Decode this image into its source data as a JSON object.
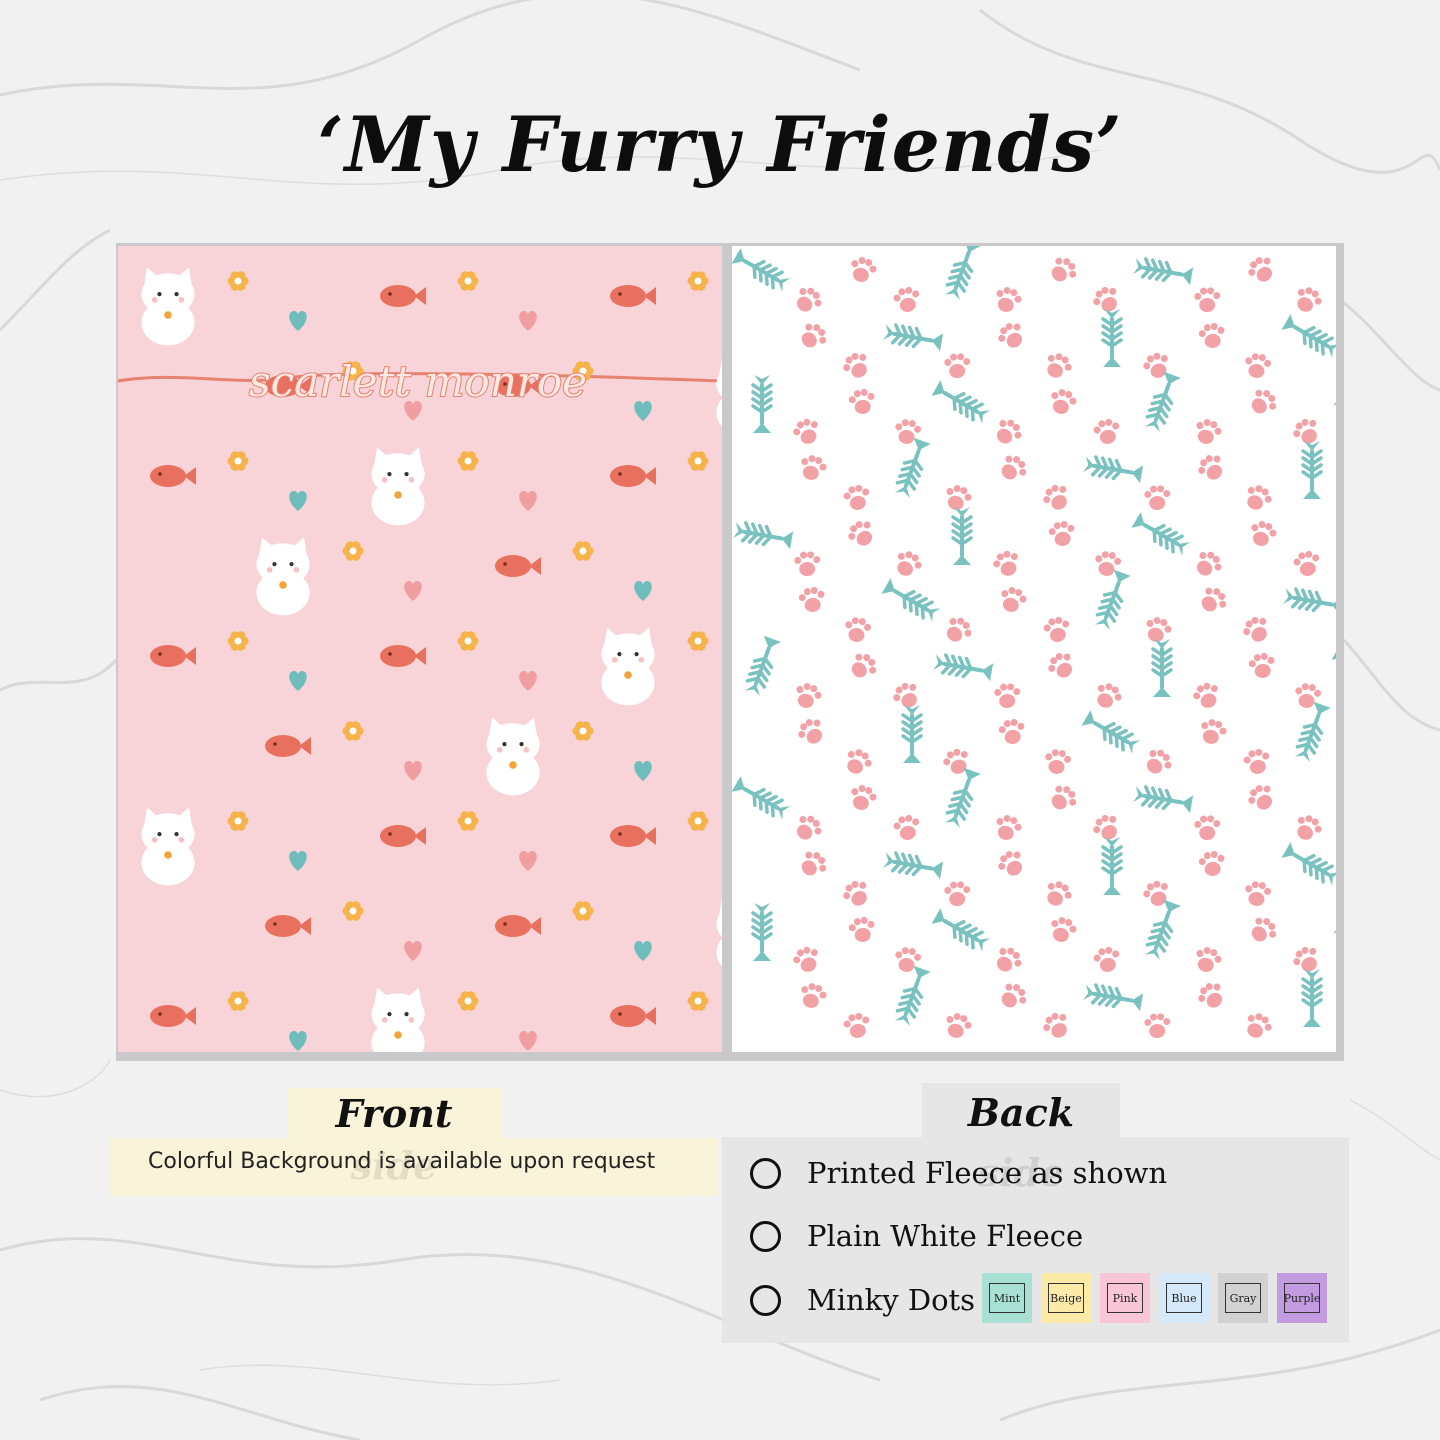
{
  "title": "‘My Furry Friends’",
  "front": {
    "label": "Front side",
    "name_text": "scarlett monroe",
    "note": "Colorful Background is available upon request",
    "background_color": "#f8d3d7"
  },
  "back": {
    "label": "Back side",
    "background_color": "#ffffff",
    "pattern_colors": {
      "fishbone": "#79c2c0",
      "paw": "#f2a2a7"
    },
    "options": [
      {
        "label": "Printed Fleece as shown"
      },
      {
        "label": "Plain White Fleece"
      },
      {
        "label": "Minky Dots"
      }
    ],
    "swatches": [
      {
        "label": "Mint",
        "color": "#a8e0d4"
      },
      {
        "label": "Beige",
        "color": "#fbeaa8"
      },
      {
        "label": "Pink",
        "color": "#f9c6d8"
      },
      {
        "label": "Blue",
        "color": "#d6e9fa"
      },
      {
        "label": "Gray",
        "color": "#d2d2d2"
      },
      {
        "label": "Purple",
        "color": "#c39be0"
      }
    ]
  }
}
